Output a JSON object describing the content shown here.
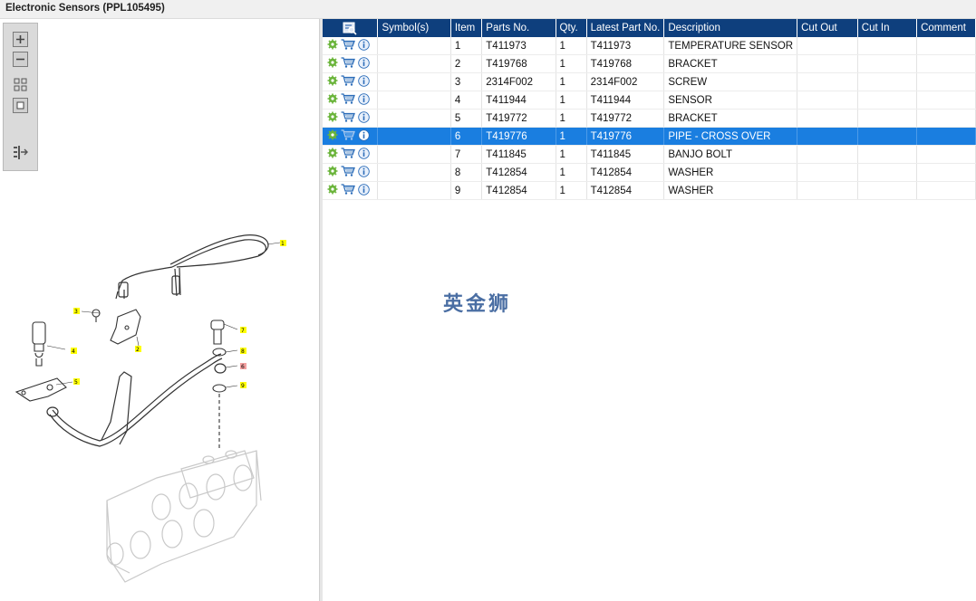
{
  "window": {
    "title": "Electronic Sensors (PPL105495)"
  },
  "columns": [
    "",
    "Symbol(s)",
    "Item",
    "Parts No.",
    "Qty.",
    "Latest Part No.",
    "Description",
    "Cut Out",
    "Cut In",
    "Comment"
  ],
  "rows": [
    {
      "item": "1",
      "parts_no": "T411973",
      "qty": "1",
      "latest": "T411973",
      "description": "TEMPERATURE SENSOR"
    },
    {
      "item": "2",
      "parts_no": "T419768",
      "qty": "1",
      "latest": "T419768",
      "description": "BRACKET"
    },
    {
      "item": "3",
      "parts_no": "2314F002",
      "qty": "1",
      "latest": "2314F002",
      "description": "SCREW"
    },
    {
      "item": "4",
      "parts_no": "T411944",
      "qty": "1",
      "latest": "T411944",
      "description": "SENSOR"
    },
    {
      "item": "5",
      "parts_no": "T419772",
      "qty": "1",
      "latest": "T419772",
      "description": "BRACKET"
    },
    {
      "item": "6",
      "parts_no": "T419776",
      "qty": "1",
      "latest": "T419776",
      "description": "PIPE - CROSS OVER"
    },
    {
      "item": "7",
      "parts_no": "T411845",
      "qty": "1",
      "latest": "T411845",
      "description": "BANJO BOLT"
    },
    {
      "item": "8",
      "parts_no": "T412854",
      "qty": "1",
      "latest": "T412854",
      "description": "WASHER"
    },
    {
      "item": "9",
      "parts_no": "T412854",
      "qty": "1",
      "latest": "T412854",
      "description": "WASHER"
    }
  ],
  "selected_item": "6",
  "watermark": "英金狮",
  "callouts": [
    "1",
    "2",
    "3",
    "4",
    "5",
    "6",
    "7",
    "8",
    "9"
  ],
  "colors": {
    "header": "#0e3f7d",
    "selected": "#1a7ee0",
    "callout_fill": "#ffff00",
    "callout_highlight": "#f4a0a0"
  }
}
